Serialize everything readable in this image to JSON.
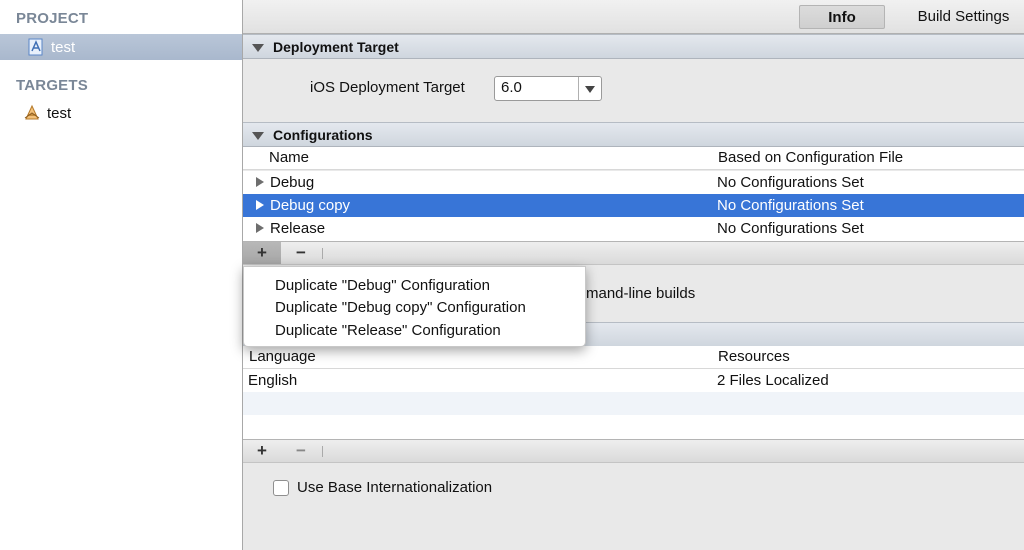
{
  "sidebar": {
    "project_header": "PROJECT",
    "project_item": "test",
    "targets_header": "TARGETS",
    "target_item": "test"
  },
  "tabs": {
    "info": "Info",
    "build_settings": "Build Settings"
  },
  "deployment": {
    "title": "Deployment Target",
    "label": "iOS Deployment Target",
    "value": "6.0"
  },
  "configurations": {
    "title": "Configurations",
    "col_name": "Name",
    "col_file": "Based on Configuration File",
    "rows": [
      {
        "name": "Debug",
        "file": "No Configurations Set"
      },
      {
        "name": "Debug copy",
        "file": "No Configurations Set"
      },
      {
        "name": "Release",
        "file": "No Configurations Set"
      }
    ],
    "add": "+",
    "remove": "−",
    "cmdline_partial": "mand-line builds"
  },
  "menu": {
    "items": [
      "Duplicate \"Debug\" Configuration",
      "Duplicate \"Debug copy\" Configuration",
      "Duplicate \"Release\" Configuration"
    ]
  },
  "localizations": {
    "col_language": "Language",
    "col_resources": "Resources",
    "rows": [
      {
        "language": "English",
        "resources": "2 Files Localized"
      }
    ],
    "add": "+",
    "remove": "−",
    "base_label": "Use Base Internationalization"
  },
  "colors": {
    "selection": "#3875d7",
    "sidebar_selection": "#aebcd0"
  }
}
